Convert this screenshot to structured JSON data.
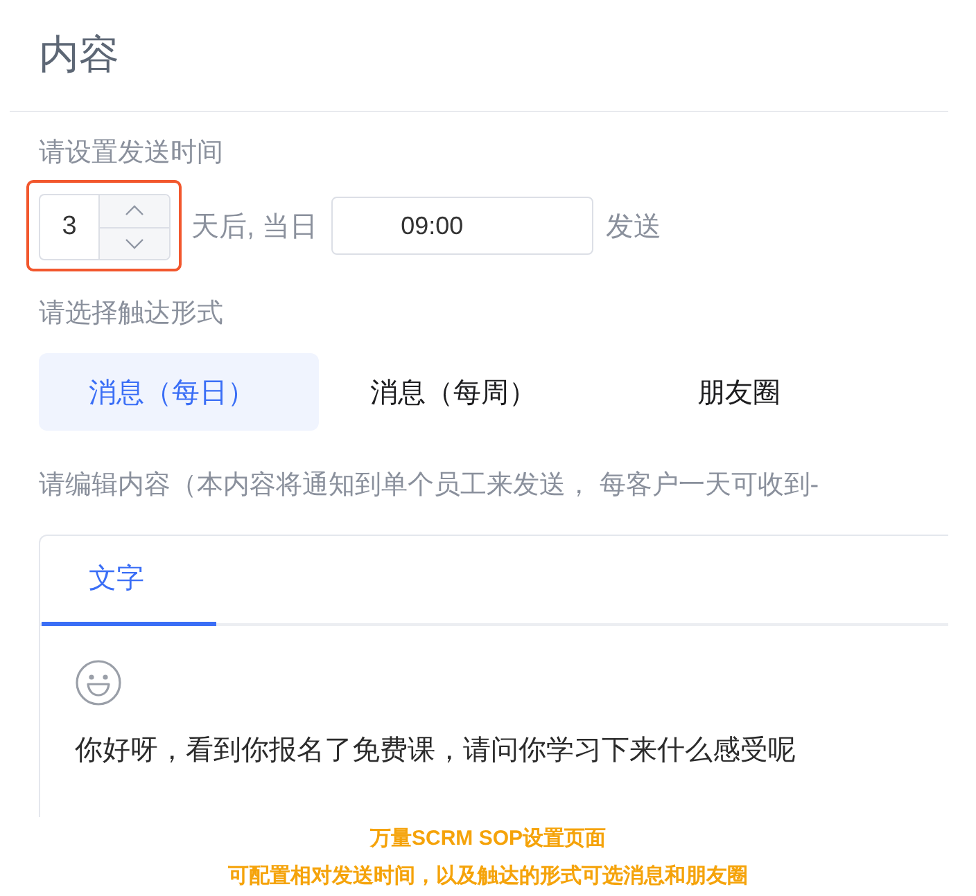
{
  "section": {
    "title": "内容"
  },
  "send_time": {
    "label": "请设置发送时间",
    "highlighted": true,
    "days": {
      "value": "3"
    },
    "after_text": "天后, 当日",
    "time": {
      "value": "09:00"
    },
    "suffix": "发送"
  },
  "reach": {
    "label": "请选择触达形式",
    "options": [
      {
        "label": "消息（每日）",
        "selected": true
      },
      {
        "label": "消息（每周）",
        "selected": false
      },
      {
        "label": "朋友圈",
        "selected": false
      }
    ]
  },
  "content": {
    "instruction": "请编辑内容（本内容将通知到单个员工来发送， 每客户一天可收到-",
    "tabs": [
      {
        "label": "文字",
        "selected": true
      }
    ],
    "message": "你好呀，看到你报名了免费课，请问你学习下来什么感受呢"
  },
  "caption": [
    "万量SCRM SOP设置页面",
    "可配置相对发送时间，以及触达的形式可选消息和朋友圈"
  ]
}
